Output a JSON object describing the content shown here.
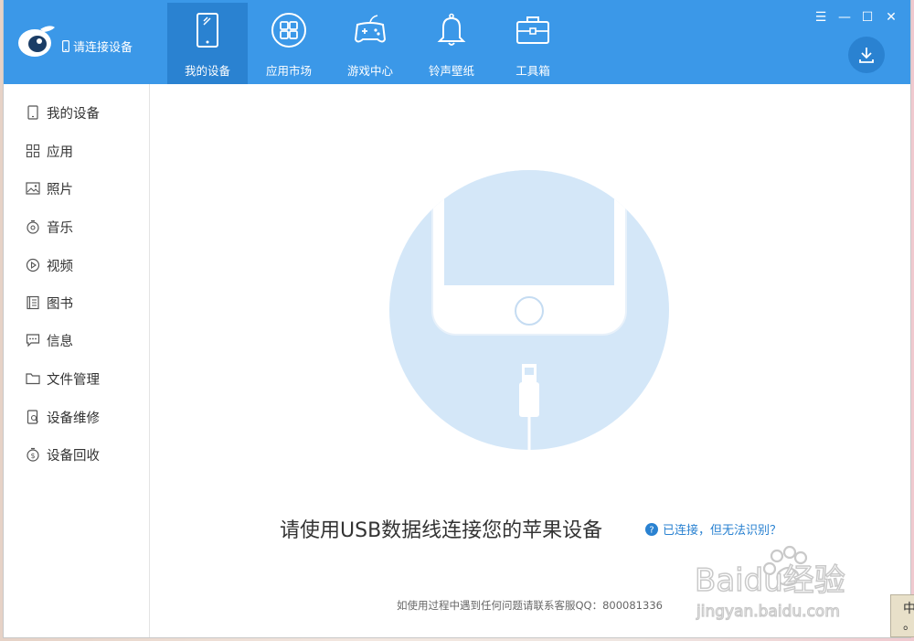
{
  "header": {
    "connect_label": "请连接设备"
  },
  "tabs": [
    {
      "label": "我的设备",
      "icon": "tablet-icon",
      "active": true
    },
    {
      "label": "应用市场",
      "icon": "apps-grid-icon"
    },
    {
      "label": "游戏中心",
      "icon": "gamepad-icon"
    },
    {
      "label": "铃声壁纸",
      "icon": "bell-icon"
    },
    {
      "label": "工具箱",
      "icon": "toolbox-icon"
    }
  ],
  "window_controls": {
    "menu": "☰",
    "minimize": "—",
    "maximize": "☐",
    "close": "✕"
  },
  "sidebar": {
    "items": [
      {
        "label": "我的设备",
        "icon": "device-icon"
      },
      {
        "label": "应用",
        "icon": "apps-icon"
      },
      {
        "label": "照片",
        "icon": "photo-icon"
      },
      {
        "label": "音乐",
        "icon": "music-icon"
      },
      {
        "label": "视频",
        "icon": "video-icon"
      },
      {
        "label": "图书",
        "icon": "book-icon"
      },
      {
        "label": "信息",
        "icon": "message-icon"
      },
      {
        "label": "文件管理",
        "icon": "folder-icon"
      },
      {
        "label": "设备维修",
        "icon": "repair-icon"
      },
      {
        "label": "设备回收",
        "icon": "recycle-icon"
      }
    ]
  },
  "main": {
    "message": "请使用USB数据线连接您的苹果设备",
    "help_link": "已连接，但无法识别？",
    "footer": "如使用过程中遇到任何问题请联系客服QQ：800081336"
  },
  "watermark": {
    "brand": "Baidu经验",
    "url": "jingyan.baidu.com"
  },
  "ime": {
    "text1": "中",
    "text2": "。"
  },
  "colors": {
    "accent": "#3b98e8",
    "accent_dark": "#2a82d1",
    "illus": "#d4e7f8"
  }
}
